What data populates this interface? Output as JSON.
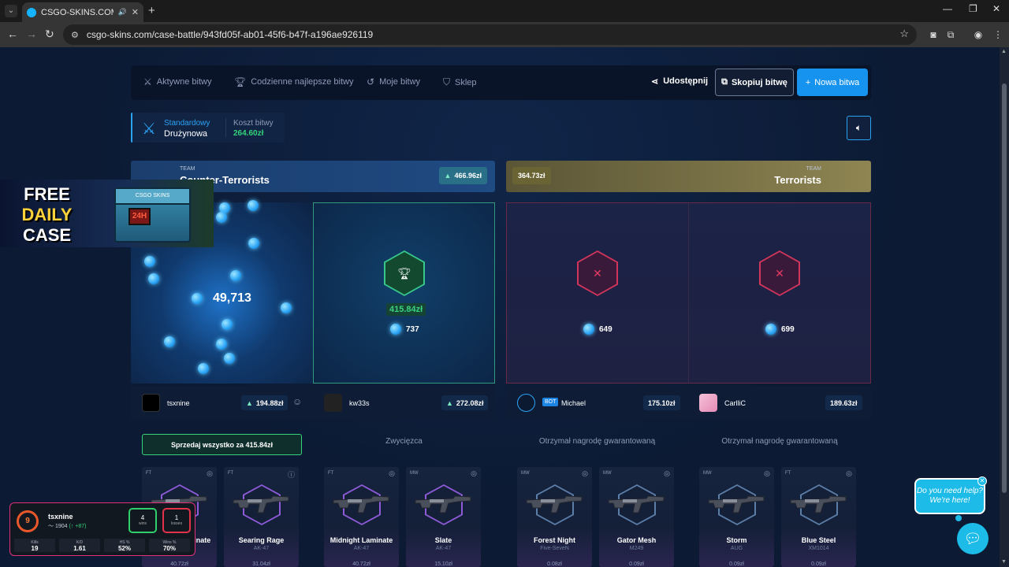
{
  "browser": {
    "tab_title": "CSGO-SKINS.COM - Najlep",
    "url": "csgo-skins.com/case-battle/943fd05f-ab01-45f6-b47f-a196ae926119"
  },
  "nav": {
    "items": [
      {
        "label": "Aktywne bitwy",
        "icon": "crossed-swords-icon"
      },
      {
        "label": "Codzienne najlepsze bitwy",
        "icon": "trophy-icon"
      },
      {
        "label": "Moje bitwy",
        "icon": "history-icon"
      },
      {
        "label": "Sklep",
        "icon": "basket-icon"
      }
    ],
    "share": "Udostępnij",
    "copy": "Skopiuj bitwę",
    "new_battle": "Nowa bitwa"
  },
  "mode": {
    "type": "Standardowy",
    "subtype": "Drużynowa",
    "cost_label": "Koszt bitwy",
    "cost": "264.60zł"
  },
  "teams": {
    "ct": {
      "label": "TEAM",
      "name": "Counter-Terrorists",
      "value": "466.96zł"
    },
    "t": {
      "label": "TEAM",
      "name": "Terrorists",
      "value": "364.73zł"
    }
  },
  "players": [
    {
      "name": "tsxnine",
      "value": "194.88zł",
      "spin": "49,713"
    },
    {
      "name": "kw33s",
      "value": "272.08zł",
      "score": "737",
      "win_amount": "415.84zł",
      "status": "Zwycięzca"
    },
    {
      "name": "Michael",
      "bot": "BOT",
      "value": "175.10zł",
      "score": "649",
      "status": "Otrzymał nagrodę gwarantowaną"
    },
    {
      "name": "CarlliC",
      "value": "189.63zł",
      "score": "699",
      "status": "Otrzymał nagrodę gwarantowaną"
    }
  ],
  "sell_all": "Sprzedaj wszystko za 415.84zł",
  "items": [
    {
      "grade": "FT",
      "name": "Midnight Laminate",
      "type": "AK-47",
      "price": "40.72zł",
      "color": "#8e5bd8"
    },
    {
      "grade": "FT",
      "name": "Searing Rage",
      "type": "AK-47",
      "price": "31.04zł",
      "color": "#8e5bd8"
    },
    {
      "grade": "FT",
      "name": "Midnight Laminate",
      "type": "AK-47",
      "price": "40.72zł",
      "color": "#8e5bd8"
    },
    {
      "grade": "MW",
      "name": "Slate",
      "type": "AK-47",
      "price": "15.10zł",
      "color": "#8e5bd8"
    },
    {
      "grade": "MW",
      "name": "Forest Night",
      "type": "Five-SeveN",
      "price": "0.08zł",
      "color": "#5b7ea8"
    },
    {
      "grade": "MW",
      "name": "Gator Mesh",
      "type": "M249",
      "price": "0.09zł",
      "color": "#5b7ea8"
    },
    {
      "grade": "MW",
      "name": "Storm",
      "type": "AUG",
      "price": "0.09zł",
      "color": "#5b7ea8"
    },
    {
      "grade": "FT",
      "name": "Blue Steel",
      "type": "XM1014",
      "price": "0.09zł",
      "color": "#5b7ea8"
    }
  ],
  "promo": {
    "line1": "FREE",
    "line2": "DAILY",
    "line3": "CASE",
    "brand": "CSGO SKINS",
    "timer": "24H"
  },
  "stats_overlay": {
    "name": "tsxnine",
    "rank": "9",
    "elo": "1904",
    "elo_change": "+87",
    "wins": "4",
    "wins_label": "wins",
    "losses": "1",
    "losses_label": "losses",
    "kills_label": "Kills",
    "kills": "19",
    "kd_label": "K/D",
    "kd": "1.61",
    "hs_label": "HS %",
    "hs": "52%",
    "winp_label": "Wins %",
    "winp": "70%"
  },
  "help": {
    "text": "Do you need help? We're here!"
  }
}
